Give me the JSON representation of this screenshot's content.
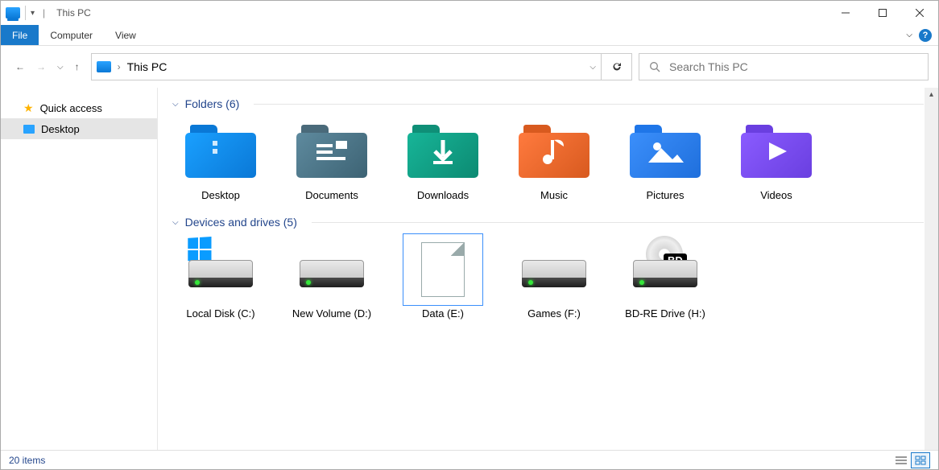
{
  "window": {
    "title": "This PC"
  },
  "ribbon": {
    "file": "File",
    "tabs": [
      "Computer",
      "View"
    ]
  },
  "nav": {
    "location": "This PC",
    "search_placeholder": "Search This PC"
  },
  "sidebar": {
    "items": [
      {
        "label": "Quick access",
        "icon": "star",
        "selected": false
      },
      {
        "label": "Desktop",
        "icon": "square",
        "selected": true
      }
    ]
  },
  "sections": [
    {
      "title": "Folders",
      "count": 6,
      "items": [
        {
          "label": "Desktop",
          "kind": "folder",
          "variant": "f-desktop",
          "glyph": ""
        },
        {
          "label": "Documents",
          "kind": "folder",
          "variant": "f-docs",
          "glyph": "doc"
        },
        {
          "label": "Downloads",
          "kind": "folder",
          "variant": "f-down",
          "glyph": "down"
        },
        {
          "label": "Music",
          "kind": "folder",
          "variant": "f-music",
          "glyph": "music"
        },
        {
          "label": "Pictures",
          "kind": "folder",
          "variant": "f-pics",
          "glyph": "pic"
        },
        {
          "label": "Videos",
          "kind": "folder",
          "variant": "f-vids",
          "glyph": "vid"
        }
      ]
    },
    {
      "title": "Devices and drives",
      "count": 5,
      "items": [
        {
          "label": "Local Disk (C:)",
          "kind": "drive",
          "variant": "os"
        },
        {
          "label": "New Volume (D:)",
          "kind": "drive",
          "variant": "plain"
        },
        {
          "label": "Data (E:)",
          "kind": "file",
          "variant": "selected"
        },
        {
          "label": "Games (F:)",
          "kind": "drive",
          "variant": "plain"
        },
        {
          "label": "BD-RE Drive (H:)",
          "kind": "drive",
          "variant": "optical"
        }
      ]
    }
  ],
  "status": {
    "text": "20 items"
  }
}
